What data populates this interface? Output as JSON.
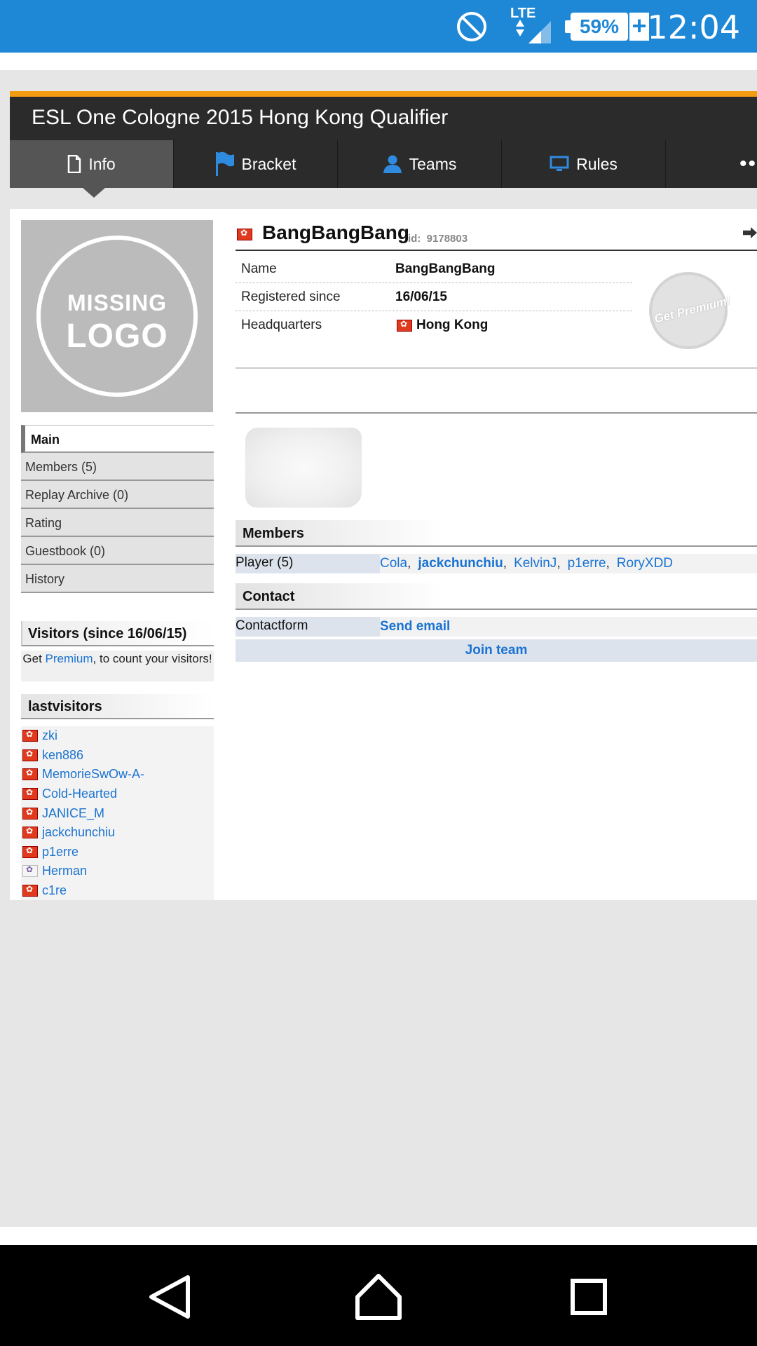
{
  "status": {
    "lte": "LTE",
    "battery": "59%",
    "time": "12:04"
  },
  "header": {
    "title": "ESL One Cologne 2015 Hong Kong Qualifier",
    "tabs": [
      {
        "label": "Info",
        "icon": "document-icon"
      },
      {
        "label": "Bracket",
        "icon": "flag-icon"
      },
      {
        "label": "Teams",
        "icon": "user-icon"
      },
      {
        "label": "Rules",
        "icon": "monitor-icon"
      }
    ],
    "more": "••"
  },
  "logo": {
    "line1": "MISSING",
    "line2": "LOGO"
  },
  "sidenav": [
    "Main",
    "Members (5)",
    "Replay Archive (0)",
    "Rating",
    "Guestbook (0)",
    "History"
  ],
  "visitors": {
    "heading": "Visitors (since 16/06/15)",
    "text_before": "Get ",
    "link": "Premium",
    "text_after": ", to count your visitors!"
  },
  "lastvisitors": {
    "heading": "lastvisitors",
    "items": [
      {
        "name": "zki",
        "flag": "hk"
      },
      {
        "name": "ken886",
        "flag": "hk"
      },
      {
        "name": "MemorieSwOw-A-",
        "flag": "hk"
      },
      {
        "name": "Cold-Hearted",
        "flag": "hk"
      },
      {
        "name": "JANICE_M",
        "flag": "hk"
      },
      {
        "name": "jackchunchiu",
        "flag": "hk"
      },
      {
        "name": "p1erre",
        "flag": "hk"
      },
      {
        "name": "Herman",
        "flag": "tw"
      },
      {
        "name": "c1re",
        "flag": "hk"
      }
    ]
  },
  "team": {
    "name": "BangBangBang",
    "id_label": "id:",
    "id": "9178803",
    "info": [
      {
        "key": "Name",
        "value": "BangBangBang"
      },
      {
        "key": "Registered since",
        "value": "16/06/15"
      },
      {
        "key": "Headquarters",
        "value": "Hong Kong"
      }
    ],
    "premium_badge": "Get Premium!"
  },
  "members": {
    "heading": "Members",
    "player_label": "Player (5)",
    "players": [
      "Cola",
      "jackchunchiu",
      "KelvinJ",
      "p1erre",
      "RoryXDD"
    ]
  },
  "contact": {
    "heading": "Contact",
    "form_label": "Contactform",
    "send_email": "Send email",
    "join_team": "Join team"
  },
  "colors": {
    "statusbar": "#1e88d6",
    "accent_orange": "#f39c12",
    "header_dark": "#2b2b2b",
    "link_blue": "#1a73d1"
  }
}
